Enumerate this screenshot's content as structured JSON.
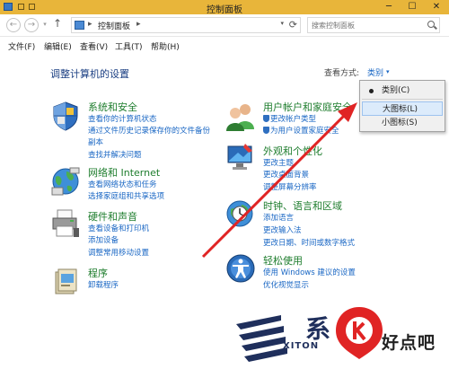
{
  "window": {
    "title": "控制面板",
    "min_label": "─",
    "max_label": "☐",
    "close_label": "✕"
  },
  "address": {
    "back_label": "←",
    "forward_label": "→",
    "history_label": "▾",
    "up_label": "↑",
    "crumb_sep_1": "▸",
    "crumb": "控制面板",
    "crumb_sep_2": "▸",
    "dropdown_label": "▾",
    "refresh_label": "⟳",
    "search_placeholder": "搜索控制面板"
  },
  "menu": {
    "items": [
      "文件(F)",
      "编辑(E)",
      "查看(V)",
      "工具(T)",
      "帮助(H)"
    ]
  },
  "main": {
    "title": "调整计算机的设置",
    "view_by_label": "查看方式:",
    "view_by_value": "类别",
    "view_by_caret": "▾"
  },
  "categories": [
    {
      "title": "系统和安全",
      "icon": "shield-icon",
      "links": [
        "查看你的计算机状态",
        "通过文件历史记录保存你的文件备份",
        "副本",
        "查找并解决问题"
      ]
    },
    {
      "title": "网络和 Internet",
      "icon": "network-globe-icon",
      "links": [
        "查看网络状态和任务",
        "选择家庭组和共享选项"
      ]
    },
    {
      "title": "硬件和声音",
      "icon": "printer-icon",
      "links": [
        "查看设备和打印机",
        "添加设备",
        "调整常用移动设置"
      ]
    },
    {
      "title": "程序",
      "icon": "programs-icon",
      "links": [
        "卸载程序"
      ]
    },
    {
      "title": "用户帐户和家庭安全",
      "icon": "users-icon",
      "links": [
        "更改帐户类型",
        "为用户设置家庭安全"
      ]
    },
    {
      "title": "外观和个性化",
      "icon": "monitor-icon",
      "links": [
        "更改主题",
        "更改桌面背景",
        "调整屏幕分辨率"
      ]
    },
    {
      "title": "时钟、语言和区域",
      "icon": "clock-globe-icon",
      "links": [
        "添加语言",
        "更改输入法",
        "更改日期、时间或数字格式"
      ]
    },
    {
      "title": "轻松使用",
      "icon": "ease-of-access-icon",
      "links": [
        "使用 Windows 建议的设置",
        "优化视觉显示"
      ]
    }
  ],
  "view_menu": {
    "options": [
      "类别(C)",
      "大图标(L)",
      "小图标(S)"
    ],
    "selected": "类别(C)",
    "highlighted": "大图标(L)"
  },
  "watermark": {
    "brand_cn": "系",
    "brand_en": "XITON",
    "site": "好点吧"
  },
  "colors": {
    "titlebar": "#e8b53a",
    "category_title": "#1e7d2d",
    "link": "#1a67c4",
    "annotation_arrow": "#e02424"
  }
}
